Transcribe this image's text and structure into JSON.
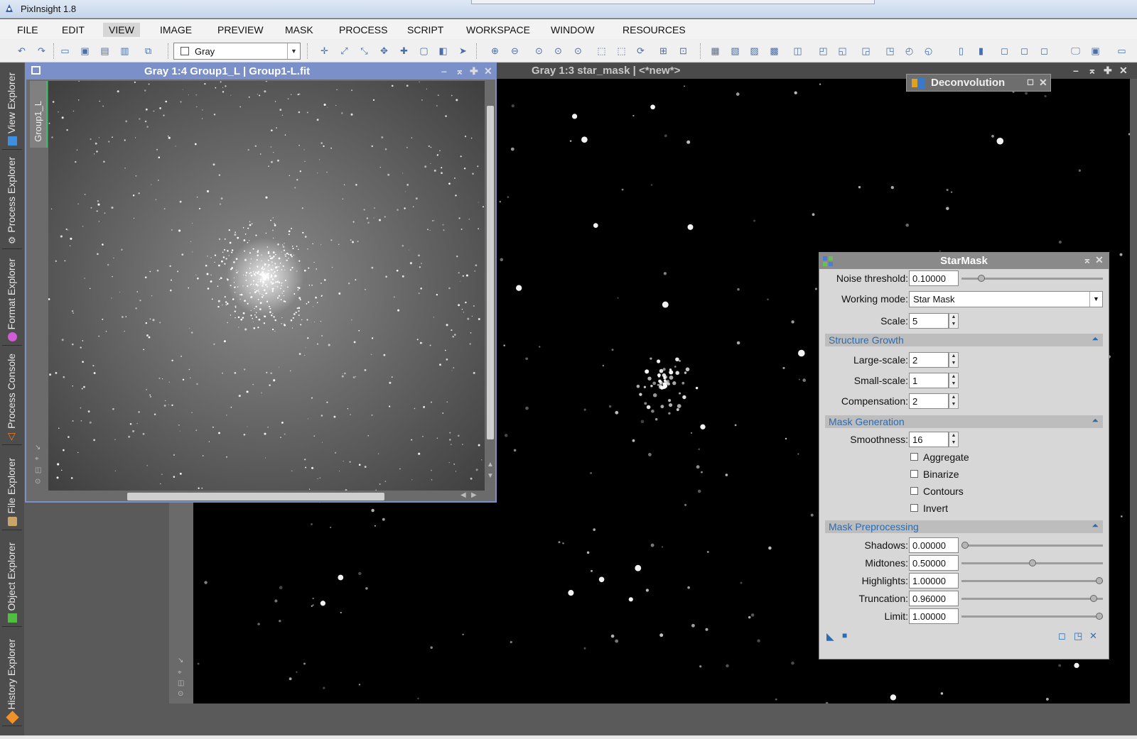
{
  "app": {
    "title": "PixInsight 1.8"
  },
  "menu": [
    "FILE",
    "EDIT",
    "VIEW",
    "IMAGE",
    "PREVIEW",
    "MASK",
    "PROCESS",
    "SCRIPT",
    "WORKSPACE",
    "WINDOW",
    "RESOURCES"
  ],
  "menu_active": "VIEW",
  "toolbar": {
    "channel_combo": "Gray"
  },
  "left_tabs": [
    "View Explorer",
    "Process Explorer",
    "Format Explorer",
    "Process Console",
    "File Explorer",
    "Object Explorer",
    "History Explorer"
  ],
  "window1": {
    "title": "Gray 1:4 Group1_L | Group1-L.fit",
    "tab": "Group1_L"
  },
  "window2": {
    "title": "Gray 1:3 star_mask | <*new*>"
  },
  "deconvolution": {
    "title": "Deconvolution"
  },
  "starmask": {
    "title": "StarMask",
    "noise_threshold": {
      "label": "Noise threshold:",
      "value": "0.10000",
      "fraction": 0.12
    },
    "working_mode": {
      "label": "Working mode:",
      "value": "Star Mask"
    },
    "scale": {
      "label": "Scale:",
      "value": "5"
    },
    "structure_growth": {
      "title": "Structure Growth",
      "large_scale": {
        "label": "Large-scale:",
        "value": "2"
      },
      "small_scale": {
        "label": "Small-scale:",
        "value": "1"
      },
      "compensation": {
        "label": "Compensation:",
        "value": "2"
      }
    },
    "mask_generation": {
      "title": "Mask Generation",
      "smoothness": {
        "label": "Smoothness:",
        "value": "16"
      },
      "aggregate": "Aggregate",
      "binarize": "Binarize",
      "contours": "Contours",
      "invert": "Invert"
    },
    "mask_preprocessing": {
      "title": "Mask Preprocessing",
      "shadows": {
        "label": "Shadows:",
        "value": "0.00000",
        "fraction": 0.0
      },
      "midtones": {
        "label": "Midtones:",
        "value": "0.50000",
        "fraction": 0.5
      },
      "highlights": {
        "label": "Highlights:",
        "value": "1.00000",
        "fraction": 1.0
      },
      "truncation": {
        "label": "Truncation:",
        "value": "0.96000",
        "fraction": 0.96
      },
      "limit": {
        "label": "Limit:",
        "value": "1.00000",
        "fraction": 1.0
      }
    }
  }
}
